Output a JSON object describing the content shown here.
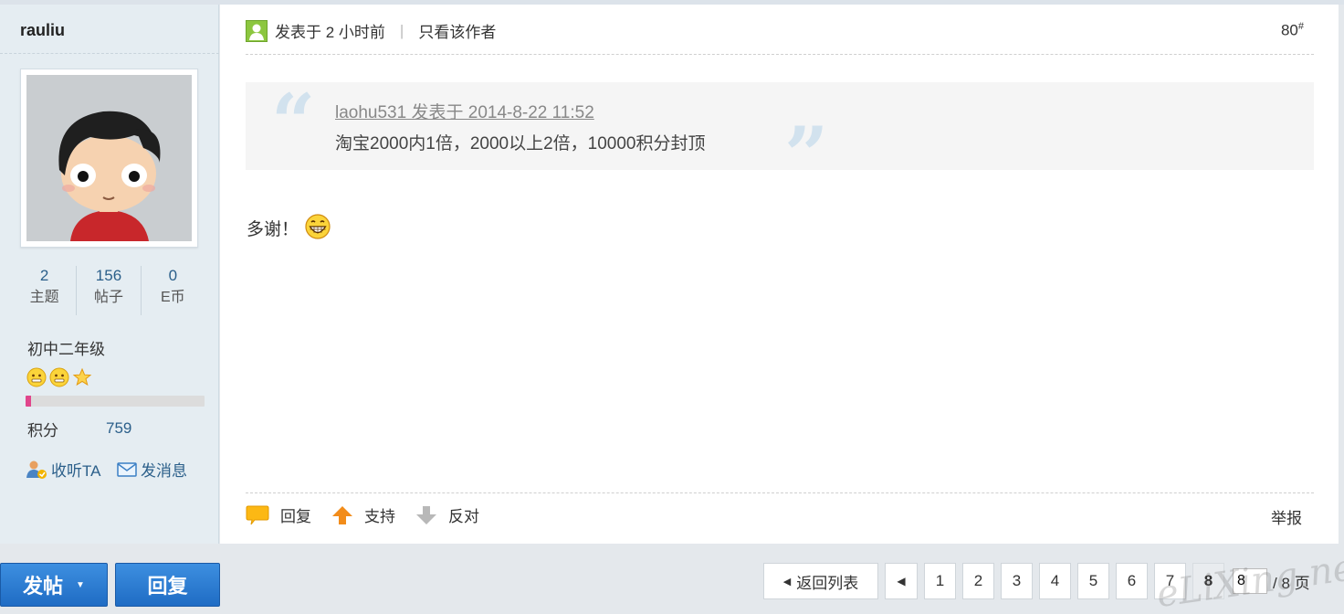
{
  "user": {
    "name": "rauliu",
    "stats": [
      {
        "value": "2",
        "label": "主题"
      },
      {
        "value": "156",
        "label": "帖子"
      },
      {
        "value": "0",
        "label": "E币"
      }
    ],
    "rank": "初中二年级",
    "level_progress": 0.03,
    "points_label": "积分",
    "points_value": "759",
    "follow_label": "收听TA",
    "message_label": "发消息"
  },
  "post": {
    "posted_label": "发表于 2 小时前",
    "only_author_label": "只看该作者",
    "floor": "80",
    "floor_mark": "#",
    "quote": {
      "author_line": "laohu531 发表于 2014-8-22 11:52",
      "text": "淘宝2000内1倍，2000以上2倍，10000积分封顶"
    },
    "body": "多谢！",
    "actions": {
      "reply": "回复",
      "support": "支持",
      "oppose": "反对",
      "report": "举报"
    }
  },
  "bottom": {
    "new_post": "发帖",
    "reply": "回复",
    "back_to_list": "返回列表",
    "pages": [
      "1",
      "2",
      "3",
      "4",
      "5",
      "6",
      "7"
    ],
    "current_page": "8",
    "page_input_value": "8",
    "page_total": "/ 8 页"
  },
  "watermark": "eLiXing.net",
  "colors": {
    "accent_blue": "#2b5f8a",
    "button_blue": "#1f6cc4",
    "progress_pink": "#e0468c"
  }
}
